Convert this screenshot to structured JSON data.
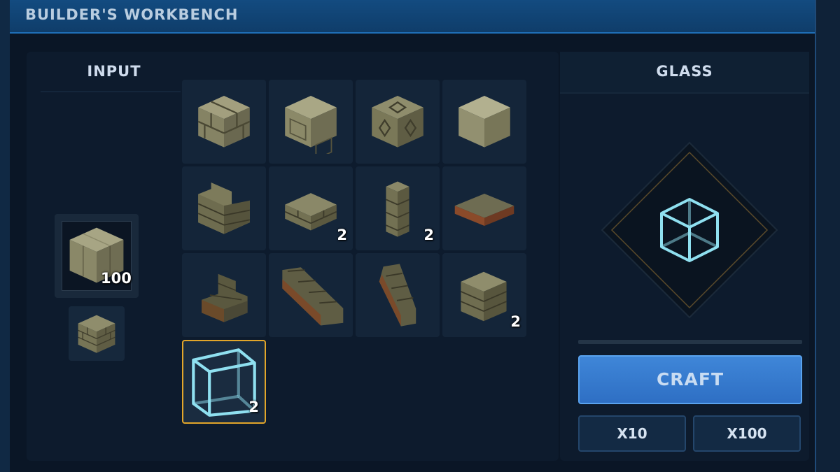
{
  "window": {
    "title": "BUILDER'S WORKBENCH"
  },
  "input": {
    "label": "INPUT",
    "main_item": {
      "icon": "stone-block-icon",
      "count": "100"
    },
    "secondary_item": {
      "icon": "stone-brick-block-icon"
    }
  },
  "recipes": [
    {
      "icon": "stone-brick-block-icon",
      "count": ""
    },
    {
      "icon": "carved-stone-block-icon",
      "count": ""
    },
    {
      "icon": "decorative-stone-block-icon",
      "count": ""
    },
    {
      "icon": "smooth-stone-block-icon",
      "count": ""
    },
    {
      "icon": "stone-brick-corner-icon",
      "count": ""
    },
    {
      "icon": "stone-brick-slab-icon",
      "count": "2"
    },
    {
      "icon": "stone-brick-pillar-icon",
      "count": "2"
    },
    {
      "icon": "stone-platform-icon",
      "count": ""
    },
    {
      "icon": "small-stone-stairs-icon",
      "count": ""
    },
    {
      "icon": "long-stone-stairs-icon",
      "count": ""
    },
    {
      "icon": "tall-stone-stairs-icon",
      "count": ""
    },
    {
      "icon": "stone-brick-half-wall-icon",
      "count": "2"
    },
    {
      "icon": "glass-block-icon",
      "count": "2",
      "selected": true
    }
  ],
  "result": {
    "title": "GLASS",
    "icon": "glass-block-icon"
  },
  "actions": {
    "craft": "CRAFT",
    "x10": "X10",
    "x100": "X100"
  },
  "colors": {
    "accent": "#3f86d8",
    "selection": "#e2a62a",
    "glass": "#8fe0f0",
    "stone": "#8a8a6a"
  }
}
